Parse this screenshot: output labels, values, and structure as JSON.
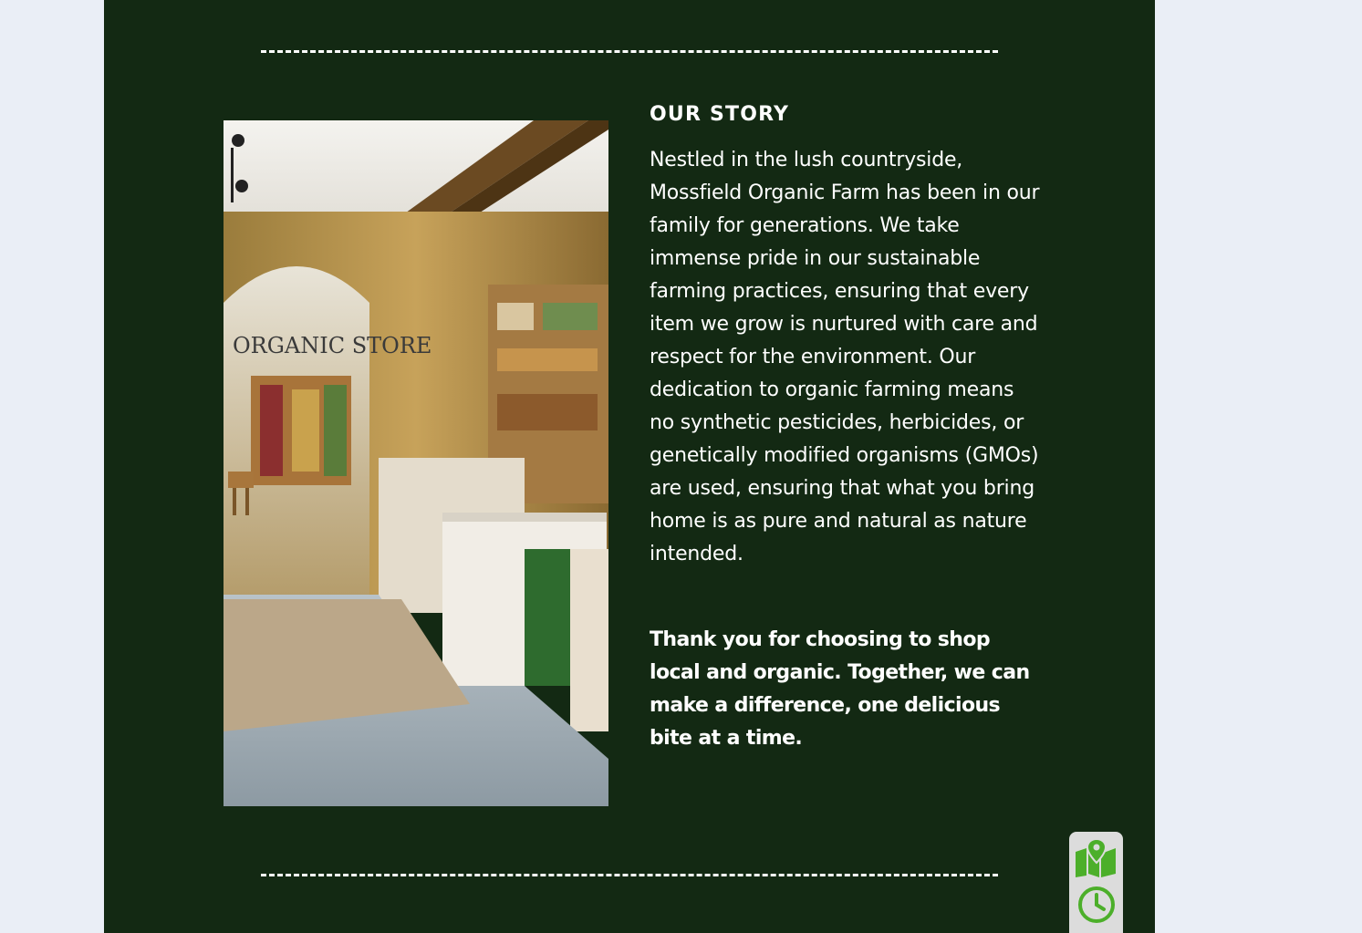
{
  "story": {
    "title": "OUR STORY",
    "body": "Nestled in the lush countryside, Mossfield Organic Farm has been in our family for generations. We take immense pride in our sustainable farming practices, ensuring that every item we grow is nurtured with care and respect for the environment. Our dedication to organic farming means no synthetic pesticides, herbicides, or genetically modified organisms (GMOs) are used, ensuring that what you bring home is as pure and natural as nature intended.",
    "thanks": "Thank you for choosing to shop local and organic. Together, we can make a difference, one delicious bite at a time."
  },
  "photo": {
    "sign_text": "ORGANIC STORE"
  },
  "widget": {
    "map_icon": "map-pin-icon",
    "clock_icon": "clock-icon",
    "accent": "#4caf2a"
  },
  "colors": {
    "panel_bg": "#132913",
    "page_bg": "#eaeef6",
    "text": "#ffffff"
  }
}
